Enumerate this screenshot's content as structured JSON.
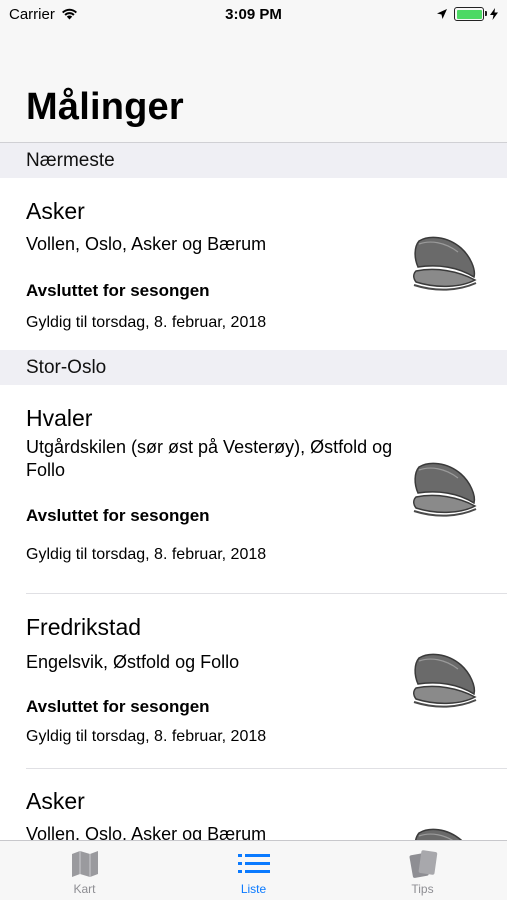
{
  "status_bar": {
    "carrier": "Carrier",
    "time": "3:09 PM"
  },
  "page": {
    "title": "Målinger"
  },
  "sections": [
    {
      "header": "Nærmeste"
    },
    {
      "header": "Stor-Oslo"
    }
  ],
  "rows": [
    {
      "title": "Asker",
      "location": "Vollen, Oslo, Asker og Bærum",
      "status": "Avsluttet for sesongen",
      "valid": "Gyldig til torsdag, 8. februar, 2018",
      "icon": "mussel-icon"
    },
    {
      "title": "Hvaler",
      "location": "Utgårdskilen (sør øst på Vesterøy), Østfold og Follo",
      "status": "Avsluttet for sesongen",
      "valid": "Gyldig til torsdag, 8. februar, 2018",
      "icon": "mussel-icon"
    },
    {
      "title": "Fredrikstad",
      "location": "Engelsvik, Østfold og Follo",
      "status": "Avsluttet for sesongen",
      "valid": "Gyldig til torsdag, 8. februar, 2018",
      "icon": "mussel-icon"
    },
    {
      "title": "Asker",
      "location": "Vollen, Oslo, Asker og Bærum",
      "icon": "mussel-icon"
    }
  ],
  "tabs": [
    {
      "label": "Kart",
      "icon": "map-icon",
      "active": false
    },
    {
      "label": "Liste",
      "icon": "list-icon",
      "active": true
    },
    {
      "label": "Tips",
      "icon": "cards-icon",
      "active": false
    }
  ],
  "colors": {
    "accent": "#0a7aff",
    "inactive": "#8e8e93",
    "battery": "#4cd964",
    "section_bg": "#efeff4"
  }
}
